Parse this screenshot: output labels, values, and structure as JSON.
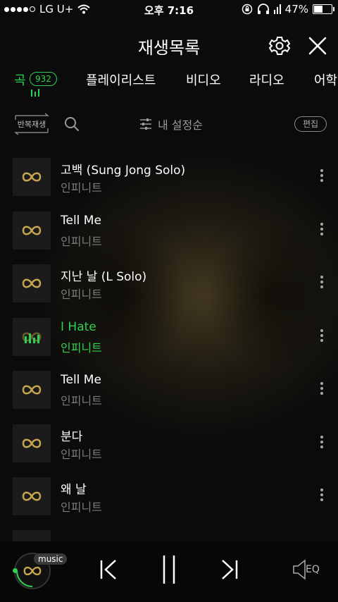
{
  "status_bar": {
    "carrier": "LG U+",
    "time": "오후 7:16",
    "battery": "47%"
  },
  "header": {
    "title": "재생목록"
  },
  "tabs": [
    {
      "label": "곡",
      "count": "932",
      "active": true
    },
    {
      "label": "플레이리스트"
    },
    {
      "label": "비디오"
    },
    {
      "label": "라디오"
    },
    {
      "label": "어학"
    }
  ],
  "toolbar": {
    "repeat_label": "반복재생",
    "sort_label": "내 설정순",
    "edit_label": "편집"
  },
  "songs": [
    {
      "title": "고백 (Sung Jong Solo)",
      "artist": "인피니트"
    },
    {
      "title": "Tell Me",
      "artist": "인피니트"
    },
    {
      "title": "지난 날 (L Solo)",
      "artist": "인피니트"
    },
    {
      "title": "I Hate",
      "artist": "인피니트",
      "playing": true
    },
    {
      "title": "Tell Me",
      "artist": "인피니트"
    },
    {
      "title": "분다",
      "artist": "인피니트"
    },
    {
      "title": "왜 날",
      "artist": "인피니트"
    }
  ],
  "player": {
    "badge": "music",
    "eq_label": "EQ"
  },
  "colors": {
    "accent": "#2ed14f",
    "logo_gold": "#c8a64e"
  }
}
